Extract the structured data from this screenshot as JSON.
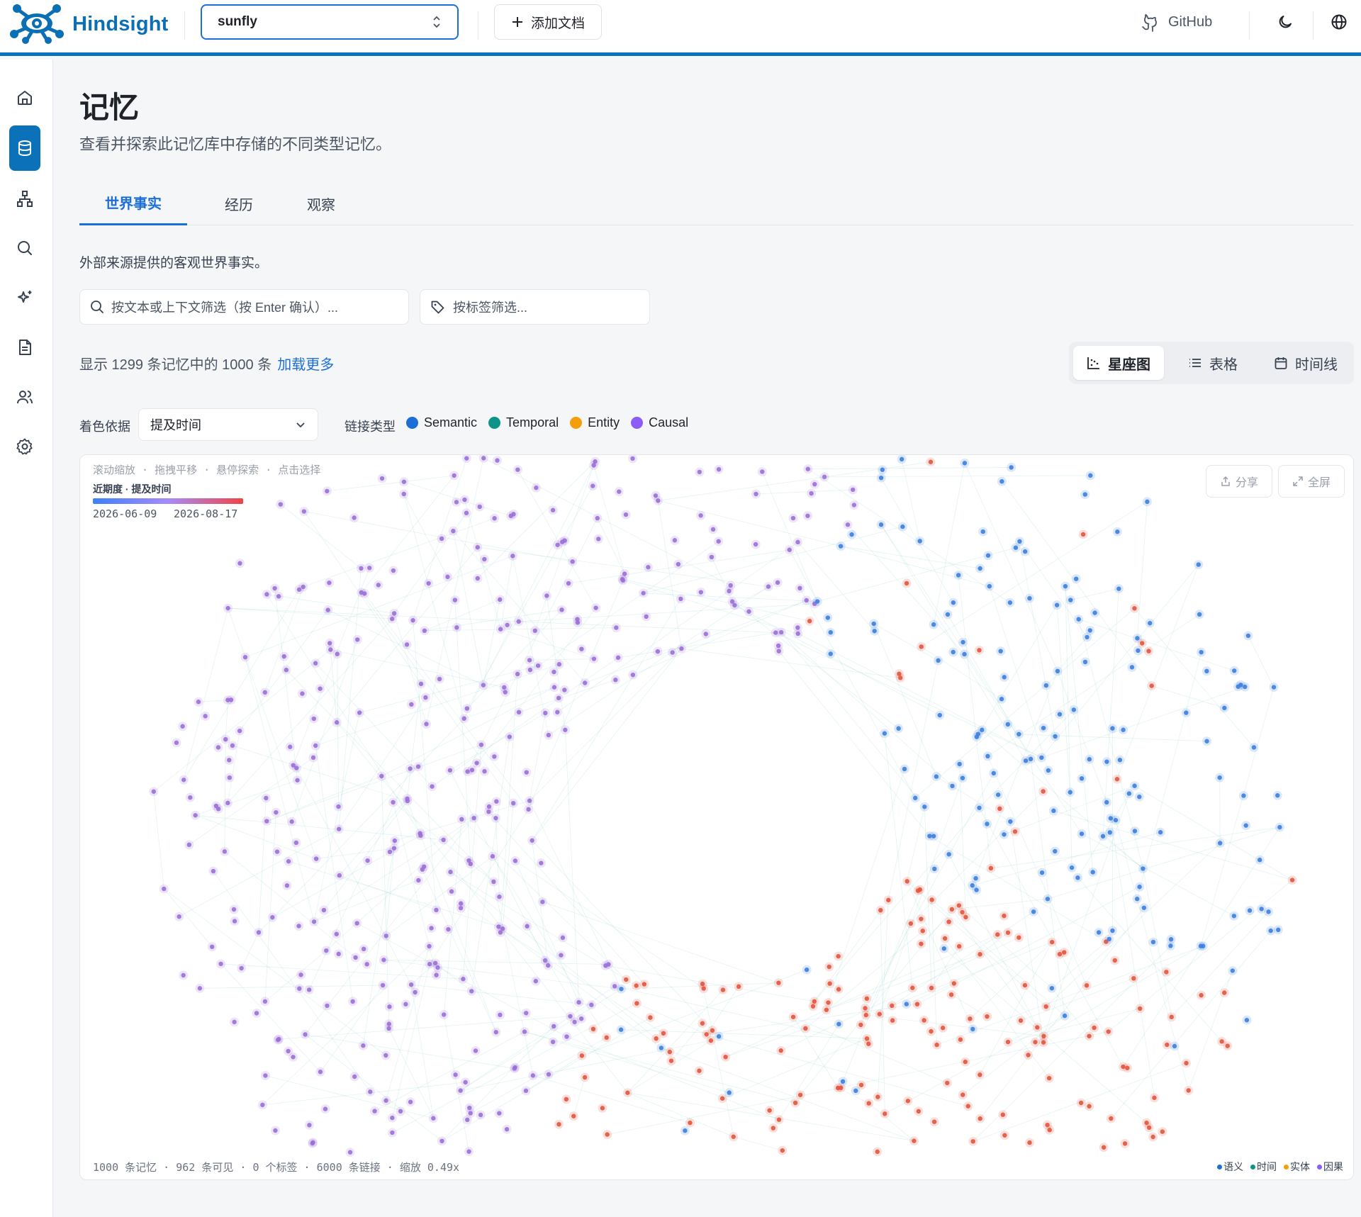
{
  "app": {
    "brand": "Hindsight"
  },
  "header": {
    "bank": "sunfly",
    "add_doc": "添加文档",
    "github": "GitHub"
  },
  "page": {
    "title": "记忆",
    "subtitle": "查看并探索此记忆库中存储的不同类型记忆。"
  },
  "tabs": [
    "世界事实",
    "经历",
    "观察"
  ],
  "tab_description": "外部来源提供的客观世界事实。",
  "filters": {
    "text_placeholder": "按文本或上下文筛选（按 Enter 确认）...",
    "tag_placeholder": "按标签筛选..."
  },
  "count": {
    "text": "显示 1299 条记忆中的 1000 条",
    "load_more": "加载更多"
  },
  "views": [
    "星座图",
    "表格",
    "时间线"
  ],
  "color_by": {
    "label": "着色依据",
    "value": "提及时间"
  },
  "link_types": {
    "label": "链接类型",
    "items": [
      {
        "name": "Semantic",
        "color": "#1d6fd8"
      },
      {
        "name": "Temporal",
        "color": "#0d9488"
      },
      {
        "name": "Entity",
        "color": "#f59e0b"
      },
      {
        "name": "Causal",
        "color": "#8b5cf6"
      }
    ]
  },
  "graph": {
    "hint": "滚动缩放 · 拖拽平移 · 悬停探索 · 点击选择",
    "recency_title": "近期度 · 提及时间",
    "recency_min": "2026-06-09",
    "recency_max": "2026-08-17",
    "share": "分享",
    "fullscreen": "全屏",
    "stats": "1000 条记忆 · 962 条可见 · 0 个标签 · 6000 条链接 · 缩放 0.49x",
    "legend": [
      {
        "label": "语义",
        "color": "#1d6fd8"
      },
      {
        "label": "时间",
        "color": "#0d9488"
      },
      {
        "label": "实体",
        "color": "#f59e0b"
      },
      {
        "label": "因果",
        "color": "#8b5cf6"
      }
    ],
    "node_colors": {
      "purple": "#9b6fd6",
      "blue": "#3b7fe0",
      "red": "#e5533d"
    }
  }
}
